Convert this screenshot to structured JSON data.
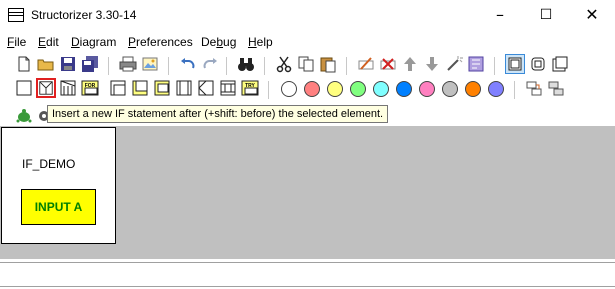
{
  "window": {
    "title": "Structorizer 3.30-14",
    "minimize": "–",
    "maximize": "☐",
    "close": "✕"
  },
  "menu": [
    {
      "label_u": "F",
      "label_rest": "ile"
    },
    {
      "label_u": "E",
      "label_rest": "dit"
    },
    {
      "label_u": "D",
      "label_rest": "iagram"
    },
    {
      "label_u": "P",
      "label_rest": "references"
    },
    {
      "label_u": "",
      "label_pre": "De",
      "label_mid": "b",
      "label_rest": "ug"
    },
    {
      "label_u": "H",
      "label_rest": "elp"
    }
  ],
  "toolbar": {
    "for_label": "FOR",
    "try_label": "TRY",
    "colors": [
      "#ffffff",
      "#ff8080",
      "#ffff80",
      "#80ff80",
      "#80ffff",
      "#0080ff",
      "#ff80c0",
      "#c0c0c0",
      "#ff8000",
      "#8080ff"
    ]
  },
  "tooltip": {
    "text": "Insert a new IF statement after (+shift: before) the selected element."
  },
  "diagram": {
    "title": "IF_DEMO",
    "element_text": "INPUT A",
    "element_color": "#ffff00"
  }
}
